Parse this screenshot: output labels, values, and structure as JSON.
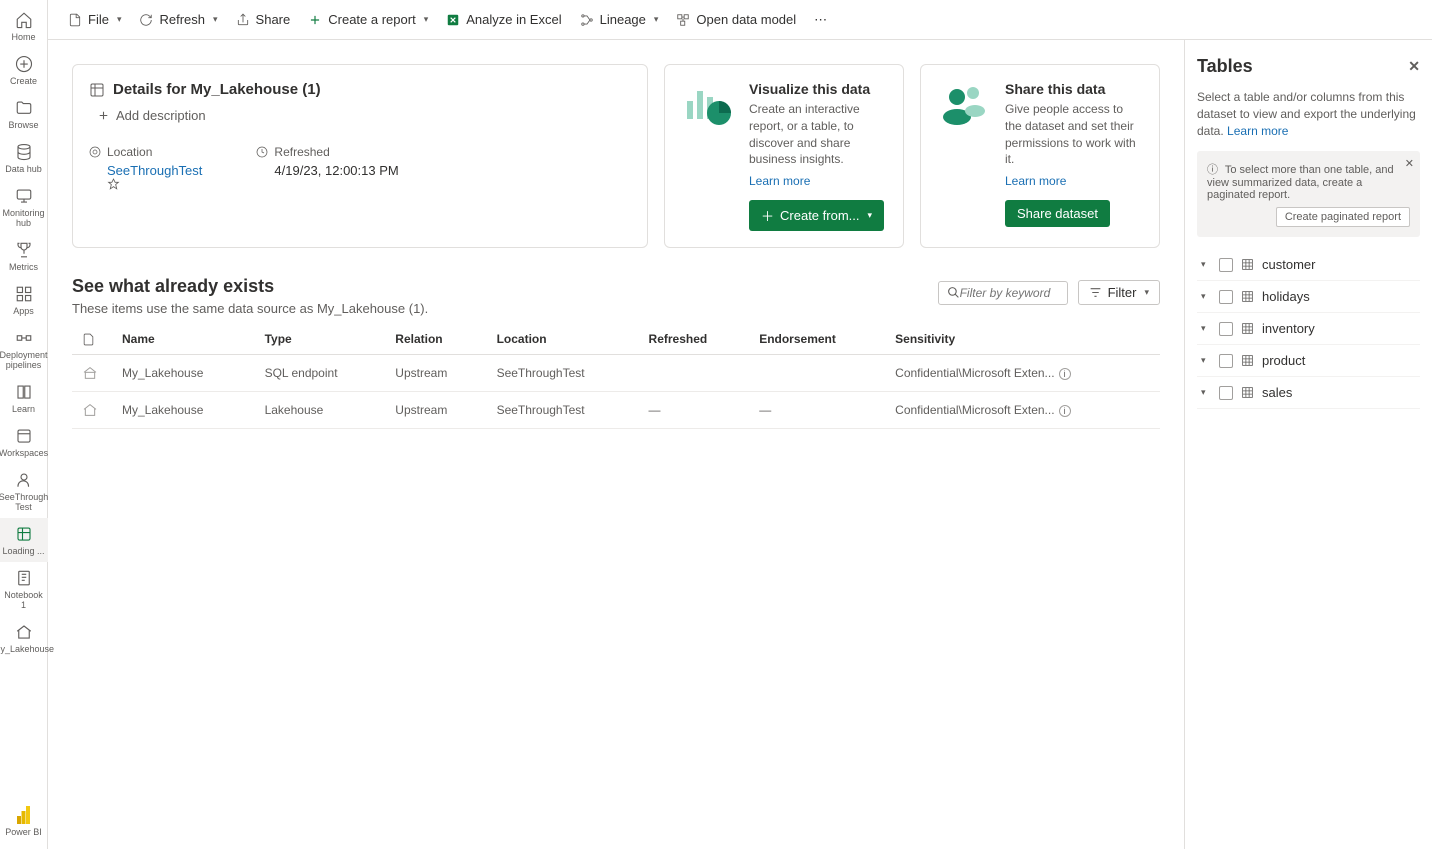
{
  "leftRail": {
    "items": [
      {
        "label": "Home"
      },
      {
        "label": "Create"
      },
      {
        "label": "Browse"
      },
      {
        "label": "Data hub"
      },
      {
        "label": "Monitoring hub"
      },
      {
        "label": "Metrics"
      },
      {
        "label": "Apps"
      },
      {
        "label": "Deployment pipelines"
      },
      {
        "label": "Learn"
      },
      {
        "label": "Workspaces"
      },
      {
        "label": "SeeThrough Test"
      },
      {
        "label": "Loading ..."
      },
      {
        "label": "Notebook 1"
      },
      {
        "label": "My_Lakehouse"
      }
    ],
    "footer": "Power BI"
  },
  "toolbar": {
    "file": "File",
    "refresh": "Refresh",
    "share": "Share",
    "createReport": "Create a report",
    "analyzeExcel": "Analyze in Excel",
    "lineage": "Lineage",
    "openModel": "Open data model"
  },
  "details": {
    "title": "Details for My_Lakehouse (1)",
    "addDescription": "Add description",
    "locationLabel": "Location",
    "locationValue": "SeeThroughTest",
    "refreshedLabel": "Refreshed",
    "refreshedValue": "4/19/23, 12:00:13 PM"
  },
  "visualize": {
    "title": "Visualize this data",
    "desc": "Create an interactive report, or a table, to discover and share business insights.",
    "learn": "Learn more",
    "button": "Create from..."
  },
  "shareCard": {
    "title": "Share this data",
    "desc": "Give people access to the dataset and set their permissions to work with it.",
    "learn": "Learn more",
    "button": "Share dataset"
  },
  "existing": {
    "heading": "See what already exists",
    "sub": "These items use the same data source as My_Lakehouse (1).",
    "filterPlaceholder": "Filter by keyword",
    "filterBtn": "Filter",
    "columns": {
      "name": "Name",
      "type": "Type",
      "relation": "Relation",
      "location": "Location",
      "refreshed": "Refreshed",
      "endorsement": "Endorsement",
      "sensitivity": "Sensitivity"
    },
    "rows": [
      {
        "name": "My_Lakehouse",
        "type": "SQL endpoint",
        "relation": "Upstream",
        "location": "SeeThroughTest",
        "refreshed": "",
        "endorsement": "",
        "sensitivity": "Confidential\\Microsoft Exten..."
      },
      {
        "name": "My_Lakehouse",
        "type": "Lakehouse",
        "relation": "Upstream",
        "location": "SeeThroughTest",
        "refreshed": "—",
        "endorsement": "—",
        "sensitivity": "Confidential\\Microsoft Exten..."
      }
    ]
  },
  "tablesPanel": {
    "title": "Tables",
    "desc": "Select a table and/or columns from this dataset to view and export the underlying data.",
    "learn": "Learn more",
    "bannerText": "To select more than one table, and view summarized data, create a paginated report.",
    "bannerBtn": "Create paginated report",
    "tables": [
      {
        "name": "customer"
      },
      {
        "name": "holidays"
      },
      {
        "name": "inventory"
      },
      {
        "name": "product"
      },
      {
        "name": "sales"
      }
    ]
  }
}
